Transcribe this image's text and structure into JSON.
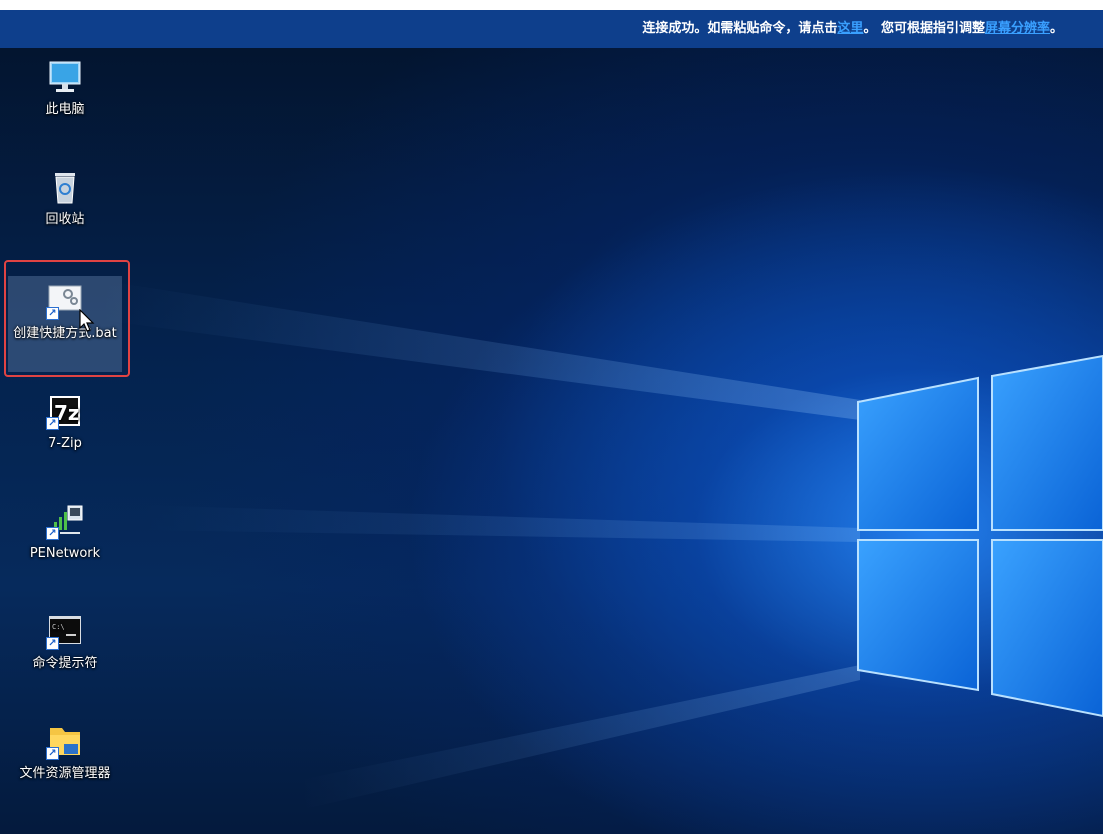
{
  "banner": {
    "part1": "连接成功。如需粘贴命令，请点击",
    "link1": "这里",
    "part2": "。 您可根据指引调整",
    "link2": "屏幕分辨率",
    "part3": "。"
  },
  "desktop_icons": [
    {
      "label": "此电脑",
      "icon": "computer-icon"
    },
    {
      "label": "回收站",
      "icon": "recycle-bin-icon"
    },
    {
      "label": "创建快捷方式.bat",
      "icon": "batch-file-icon",
      "selected": true
    },
    {
      "label": "7-Zip",
      "icon": "7zip-icon"
    },
    {
      "label": "PENetwork",
      "icon": "network-icon"
    },
    {
      "label": "命令提示符",
      "icon": "command-prompt-icon"
    },
    {
      "label": "文件资源管理器",
      "icon": "file-explorer-icon"
    }
  ],
  "colors": {
    "banner_bg": "#0e3f8c",
    "link": "#3aa0ff",
    "selection_border": "#e04343"
  }
}
